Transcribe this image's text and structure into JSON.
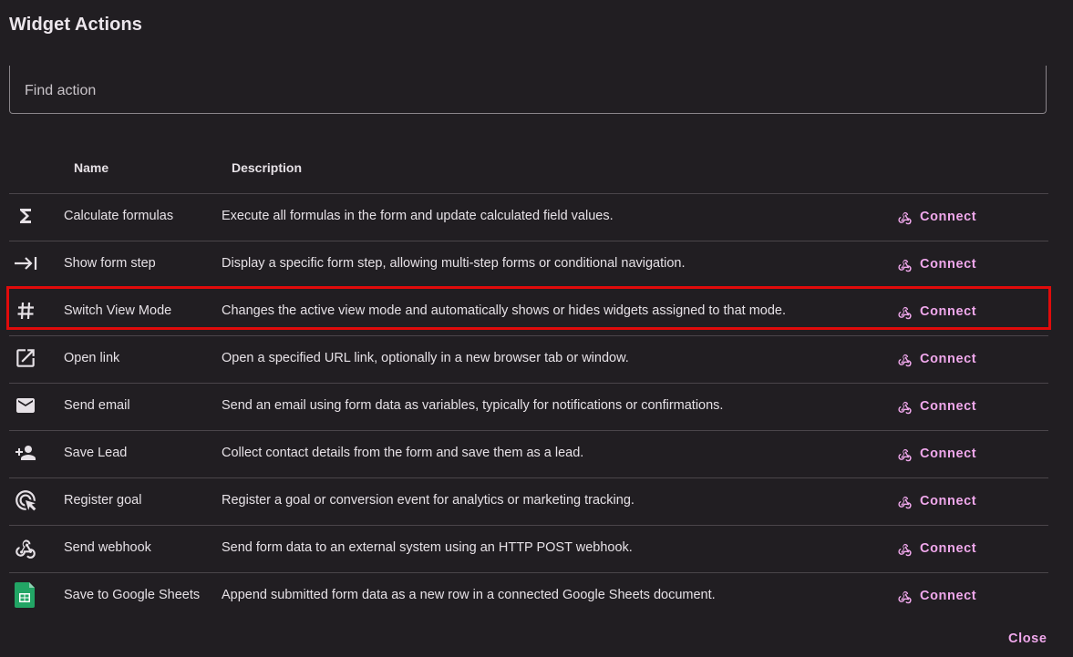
{
  "dialog": {
    "title": "Widget Actions",
    "search_placeholder": "Find action",
    "close_label": "Close"
  },
  "table": {
    "headers": {
      "name": "Name",
      "description": "Description"
    },
    "rows": [
      {
        "icon": "sigma-icon",
        "name": "Calculate formulas",
        "description": "Execute all formulas in the form and update calculated field values.",
        "action": "Connect"
      },
      {
        "icon": "arrow-to-line-icon",
        "name": "Show form step",
        "description": "Display a specific form step, allowing multi-step forms or conditional navigation.",
        "action": "Connect"
      },
      {
        "icon": "hashtag-icon",
        "name": "Switch View Mode",
        "description": "Changes the active view mode and automatically shows or hides widgets assigned to that mode.",
        "action": "Connect",
        "highlighted": true
      },
      {
        "icon": "open-in-new-icon",
        "name": "Open link",
        "description": "Open a specified URL link, optionally in a new browser tab or window.",
        "action": "Connect"
      },
      {
        "icon": "email-icon",
        "name": "Send email",
        "description": "Send an email using form data as variables, typically for notifications or confirmations.",
        "action": "Connect"
      },
      {
        "icon": "person-add-icon",
        "name": "Save Lead",
        "description": "Collect contact details from the form and save them as a lead.",
        "action": "Connect"
      },
      {
        "icon": "ads-click-icon",
        "name": "Register goal",
        "description": "Register a goal or conversion event for analytics or marketing tracking.",
        "action": "Connect"
      },
      {
        "icon": "webhook-icon",
        "name": "Send webhook",
        "description": "Send form data to an external system using an HTTP POST webhook.",
        "action": "Connect"
      },
      {
        "icon": "google-sheets-icon",
        "name": "Save to Google Sheets",
        "description": "Append submitted form data as a new row in a connected Google Sheets document.",
        "action": "Connect"
      }
    ]
  },
  "colors": {
    "background": "#211e22",
    "accent": "#f0a8ec",
    "highlight_border": "#e00b0b",
    "divider": "#4a454a"
  }
}
